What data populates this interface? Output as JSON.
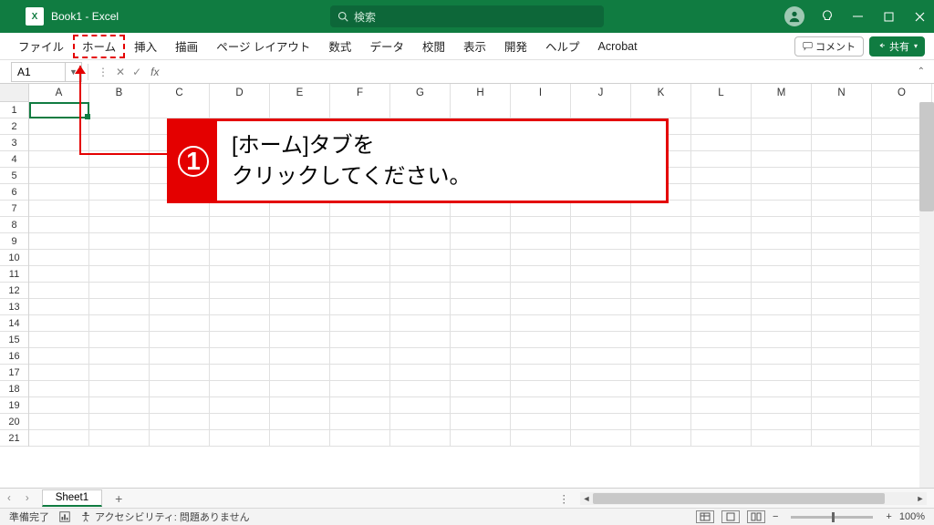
{
  "title": "Book1  -  Excel",
  "search_placeholder": "検索",
  "tabs": [
    "ファイル",
    "ホーム",
    "挿入",
    "描画",
    "ページ レイアウト",
    "数式",
    "データ",
    "校閲",
    "表示",
    "開発",
    "ヘルプ",
    "Acrobat"
  ],
  "active_tab_index": 1,
  "comment_btn": "コメント",
  "share_btn": "共有",
  "name_box": "A1",
  "columns": [
    "A",
    "B",
    "C",
    "D",
    "E",
    "F",
    "G",
    "H",
    "I",
    "J",
    "K",
    "L",
    "M",
    "N",
    "O"
  ],
  "row_count": 21,
  "active_cell": "A1",
  "sheet_tab": "Sheet1",
  "status": {
    "ready": "準備完了",
    "accessibility": "アクセシビリティ: 問題ありません",
    "zoom": "100%"
  },
  "callout": {
    "num": "1",
    "line1": "[ホーム]タブを",
    "line2": "クリックしてください。"
  }
}
